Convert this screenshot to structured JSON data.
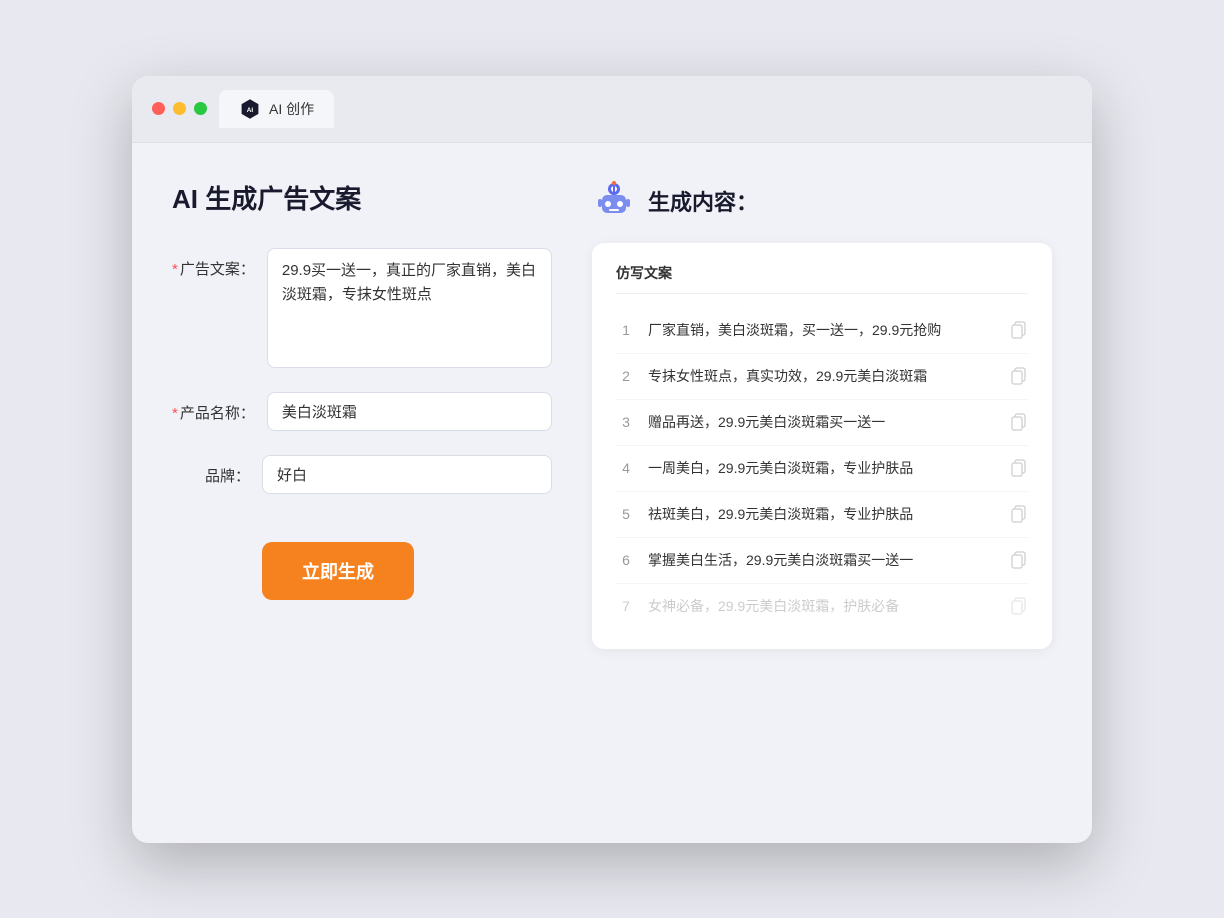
{
  "window": {
    "tab_label": "AI 创作"
  },
  "page": {
    "title": "AI 生成广告文案"
  },
  "form": {
    "ad_copy_label": "广告文案：",
    "ad_copy_required": "*",
    "ad_copy_value": "29.9买一送一，真正的厂家直销，美白淡斑霜，专抹女性斑点",
    "product_name_label": "产品名称：",
    "product_name_required": "*",
    "product_name_value": "美白淡斑霜",
    "brand_label": "品牌：",
    "brand_value": "好白",
    "generate_button": "立即生成"
  },
  "result": {
    "title": "生成内容：",
    "table_header": "仿写文案",
    "items": [
      {
        "num": "1",
        "text": "厂家直销，美白淡斑霜，买一送一，29.9元抢购",
        "dimmed": false
      },
      {
        "num": "2",
        "text": "专抹女性斑点，真实功效，29.9元美白淡斑霜",
        "dimmed": false
      },
      {
        "num": "3",
        "text": "赠品再送，29.9元美白淡斑霜买一送一",
        "dimmed": false
      },
      {
        "num": "4",
        "text": "一周美白，29.9元美白淡斑霜，专业护肤品",
        "dimmed": false
      },
      {
        "num": "5",
        "text": "祛斑美白，29.9元美白淡斑霜，专业护肤品",
        "dimmed": false
      },
      {
        "num": "6",
        "text": "掌握美白生活，29.9元美白淡斑霜买一送一",
        "dimmed": false
      },
      {
        "num": "7",
        "text": "女神必备，29.9元美白淡斑霜，护肤必备",
        "dimmed": true
      }
    ]
  }
}
